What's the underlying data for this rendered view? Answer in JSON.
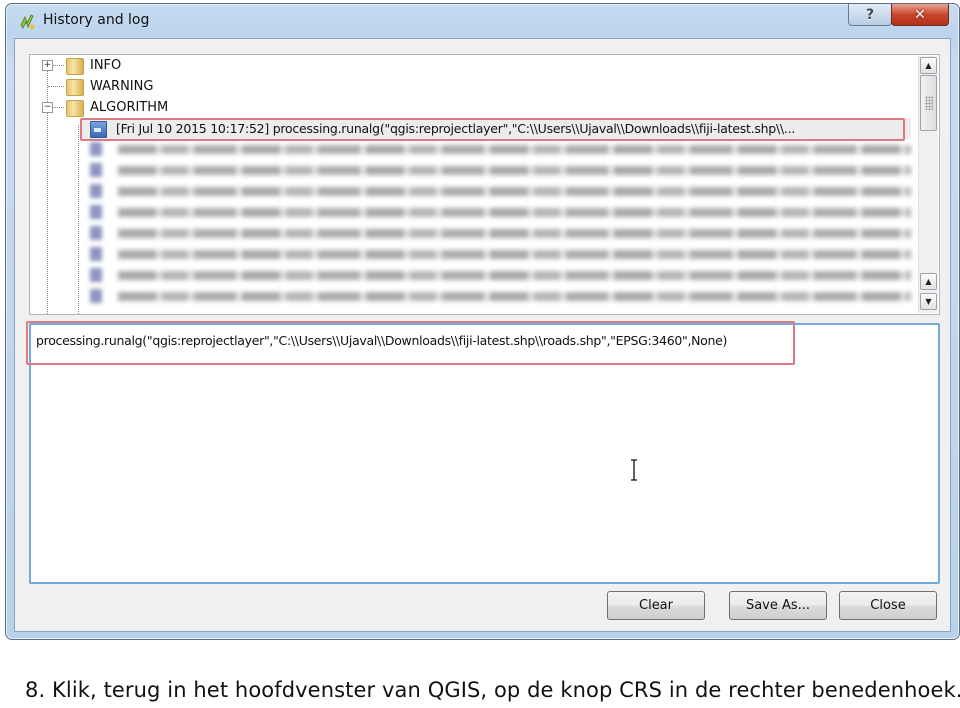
{
  "window": {
    "title": "History and log",
    "help_label": "?",
    "close_label": "✕"
  },
  "tree": {
    "categories": [
      {
        "label": "INFO",
        "expander": "+"
      },
      {
        "label": "WARNING",
        "expander": ""
      },
      {
        "label": "ALGORITHM",
        "expander": "−"
      }
    ],
    "selected_entry": "[Fri Jul 10 2015 10:17:52] processing.runalg(\"qgis:reprojectlayer\",\"C:\\\\Users\\\\Ujaval\\\\Downloads\\\\fiji-latest.shp\\\\...",
    "redacted_entries_count": 8
  },
  "detail": {
    "command": "processing.runalg(\"qgis:reprojectlayer\",\"C:\\\\Users\\\\Ujaval\\\\Downloads\\\\fiji-latest.shp\\\\roads.shp\",\"EPSG:3460\",None)"
  },
  "buttons": {
    "clear": "Clear",
    "save_as": "Save As...",
    "close": "Close"
  },
  "caption": "8. Klik, terug in het hoofdvenster van QGIS, op de knop CRS in de rechter benedenhoek.",
  "colors": {
    "highlight": "#e07a82",
    "focus_border": "#74a9de",
    "close_button": "#c9462c"
  }
}
